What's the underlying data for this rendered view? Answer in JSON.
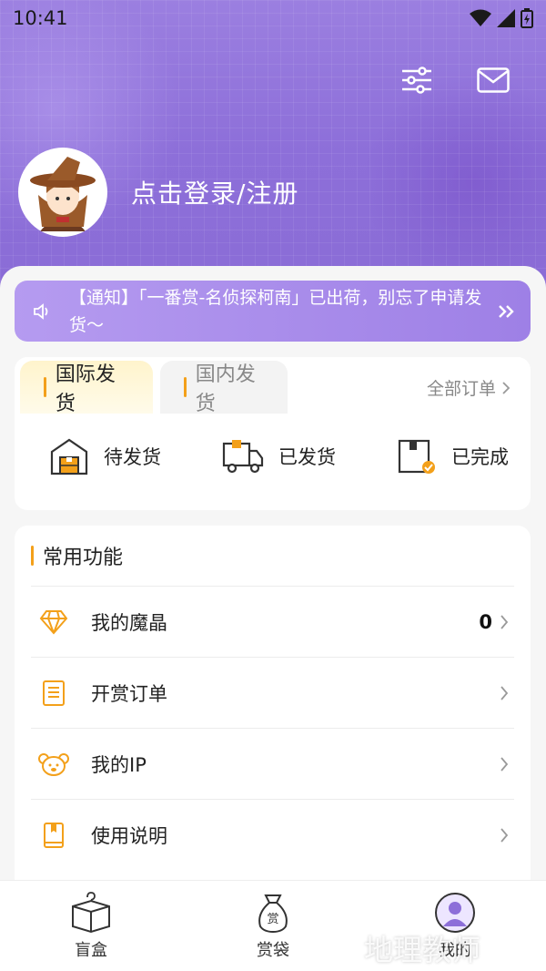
{
  "status_bar": {
    "time": "10:41"
  },
  "profile": {
    "login_text": "点击登录/注册"
  },
  "notice": {
    "text": "【通知】「一番赏-名侦探柯南」已出荷，别忘了申请发货～"
  },
  "shipping": {
    "tabs": [
      {
        "label": "国际发货",
        "active": true
      },
      {
        "label": "国内发货",
        "active": false
      }
    ],
    "all_orders": "全部订单",
    "items": [
      {
        "label": "待发货",
        "icon": "warehouse-icon"
      },
      {
        "label": "已发货",
        "icon": "truck-icon"
      },
      {
        "label": "已完成",
        "icon": "completed-box-icon"
      }
    ]
  },
  "functions": {
    "title": "常用功能",
    "rows": [
      {
        "label": "我的魔晶",
        "count": "0",
        "icon": "diamond-icon"
      },
      {
        "label": "开赏订单",
        "icon": "order-list-icon"
      },
      {
        "label": "我的IP",
        "icon": "bear-icon"
      },
      {
        "label": "使用说明",
        "icon": "book-icon"
      }
    ]
  },
  "tabbar": {
    "tabs": [
      {
        "label": "盲盒",
        "icon": "mystery-box-icon"
      },
      {
        "label": "赏袋",
        "icon": "prize-bag-icon"
      },
      {
        "label": "我的",
        "icon": "profile-icon"
      }
    ]
  },
  "watermark": "地理教师",
  "colors": {
    "accent": "#8d6fd9",
    "highlight": "#f3a01a"
  }
}
